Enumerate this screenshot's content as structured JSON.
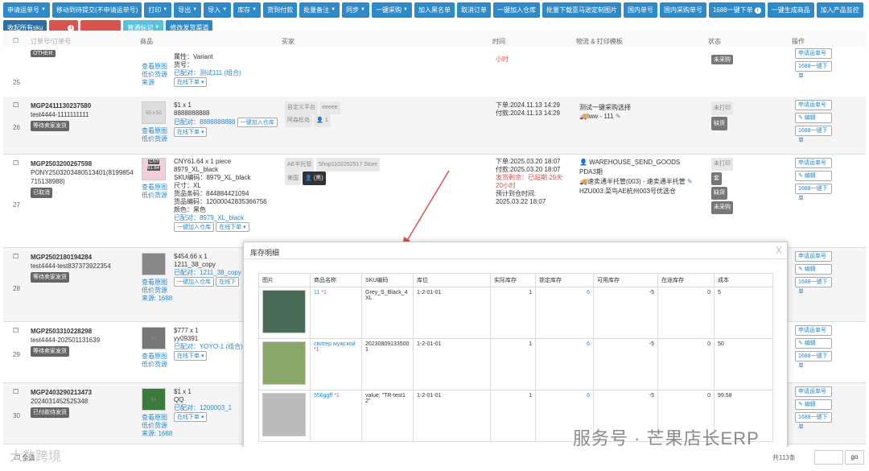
{
  "toolbar": {
    "row1": [
      "申请运单号",
      "移动到待提交(不申请运单号)",
      "打印",
      "导出",
      "导入",
      "库存",
      "货到付款",
      "批量备注",
      "同步",
      "一键采购",
      "加入黑名单",
      "取消订单",
      "一键加入仓库",
      "批量下载亚马逊定制图片",
      "国内单号",
      "国内采购单号",
      "1688一键下单",
      "一键生成商品",
      "加入产品监控"
    ],
    "row2": [
      "收起所有sku",
      "删除",
      "异常标记",
      "普通标记",
      "修改发货渠道"
    ]
  },
  "table": {
    "headers": [
      "全选",
      "商品",
      "买家",
      "时间",
      "物流 & 打印模板",
      "状态",
      "操作"
    ],
    "rows": [
      {
        "n": "25",
        "order": "OTHER",
        "attr": "属性：Variant",
        "hh": "货号：",
        "matched": "已配对：测试111 (组合)",
        "online": "在线下单",
        "status": "未采购",
        "apply": "申请运单号",
        "p1688": "1688一键下单",
        "time2": "小时",
        "link1": "查看原图",
        "link2": "低价货源",
        "link3": "来源"
      },
      {
        "n": "26",
        "order": "MGP2411130237580",
        "user": "test4444-1111111111",
        "tag": "等待卖家发货",
        "thumb": "50 x 50",
        "price": "$1 x 1",
        "sku": "8888888888",
        "matched": "已配对：8888888888",
        "addwh": "一键加入仓库",
        "online": "在线下单",
        "plat": "自定义平台",
        "buyer": "eeeee",
        "country": "阿森松岛",
        "qty": "1",
        "ordered": "下单:2024.11.13 14:29",
        "paid": "付款:2024.11.13 14:29",
        "logistics": "测试一键采购选择",
        "method": "lww - 111",
        "s1": "未打印",
        "s2": "缺货",
        "apply": "申请运单号",
        "edit": "编辑",
        "p1688": "1688一键下单",
        "link1": "查看原图",
        "link2": "低价货源"
      },
      {
        "n": "27",
        "order": "MGP2503200267598",
        "user": "PONY2503203480513401(8199854715138988)",
        "tag": "已取消",
        "thumb": "CNY 61.64",
        "price": "CNY61.64 x 1 piece",
        "sku": "8979_XL_black",
        "skuc": "SKU编码：8979_XL_black",
        "size": "尺寸：XL",
        "bar": "货品条码：844884421094",
        "code": "货品编码：12000042835366756",
        "color": "颜色：黑色",
        "matched": "已配对：8979_XL_black",
        "addwh": "一键加入仓库",
        "online": "在线下单",
        "plat": "AE半托管",
        "store": "Shop1102252517 Store",
        "country": "美国",
        "buyer": "(黑)",
        "ordered": "下单:2025.03.20 18:07",
        "paid": "付款:2025.03.20 18:07",
        "remain": "发货剩余：已超期 29天20小时",
        "eta": "预计到仓时间:",
        "etad": "2025.03.22 18:07",
        "wh": "WAREHOUSE_SEND_GOODS",
        "pda": "PDA3期",
        "method": "速卖通半托管(003) - 速卖通半托管",
        "hzu": "HZU003:菜鸟AE杭州003号优选仓",
        "s1": "未打印",
        "s2": "套",
        "s3": "缺货",
        "s4": "未采购",
        "apply": "申请运单号",
        "edit": "编辑",
        "p1688": "1688一键下单",
        "link1": "查看原图",
        "link2": "低价货源"
      },
      {
        "n": "28",
        "order": "MGP2502180194284",
        "user": "test4444-test837373922354",
        "tag": "等待卖家发货",
        "thumb": "$1",
        "price": "$454.66 x 1",
        "sku": "1211_38_copy",
        "matched": "已配对：1211_38_copy",
        "addwh": "一键加入仓库",
        "online": "在线下",
        "source": "来源: 1688",
        "apply": "申请运单号",
        "edit": "编辑",
        "p1688": "1688一键下单",
        "link1": "查看原图",
        "link2": "低价货源"
      },
      {
        "n": "29",
        "order": "MGP2503310228298",
        "user": "test4444-202501131639",
        "tag": "等待卖家发货",
        "thumb": "$1",
        "price": "$777 x 1",
        "sku": "yy09391",
        "matched": "已配对：YOYO-1 (组合)",
        "online": "在线下单",
        "apply": "申请运单号",
        "edit": "编辑",
        "p1688": "1688一键下单",
        "link1": "查看原图",
        "link2": "低价货源"
      },
      {
        "n": "30",
        "order": "MGP2403290213473",
        "user": "2024031452525348",
        "tag": "已付款待发货",
        "thumb": "$1",
        "price": "$1 x 1",
        "sku": "QQ",
        "matched": "已配对：1200003_1",
        "online": "在线下单",
        "source": "来源: 1688",
        "apply": "申请运单号",
        "edit": "编辑",
        "p1688": "1688一键下单",
        "link1": "查看原图",
        "link2": "低价货源"
      }
    ]
  },
  "modal": {
    "title": "库存明细",
    "close": "X",
    "headers": [
      "图片",
      "商品名称",
      "SKU编码",
      "库位",
      "实际库存",
      "锁定库存",
      "可用库存",
      "在途库存",
      "成本"
    ],
    "rows": [
      {
        "name": "11",
        "mark": "*1",
        "sku": "Grey_S_Black_4XL",
        "loc": "1-2-01-01",
        "actual": "1",
        "locked": "6",
        "avail": "-5",
        "transit": "0",
        "cost": "5"
      },
      {
        "name": "свитер мужской",
        "mark": "*1",
        "sku": "202308091335001",
        "loc": "1-2-01-01",
        "actual": "1",
        "locked": "6",
        "avail": "-5",
        "transit": "0",
        "cost": "50"
      },
      {
        "name": "556ggff",
        "mark": "*1",
        "sku": "value: \"TR-test12\"",
        "loc": "1-2-01-01",
        "actual": "1",
        "locked": "6",
        "avail": "-5",
        "transit": "0",
        "cost": "99.58"
      }
    ]
  },
  "pager": {
    "total": "共113条",
    "go": "go",
    "select_all": "全选"
  },
  "watermark": {
    "right": "服务号 · 芒果店长ERP",
    "left": "大数跨境"
  },
  "colors": {
    "primary": "#2d89c8",
    "danger": "#d9534f",
    "success": "#5cb85c"
  }
}
